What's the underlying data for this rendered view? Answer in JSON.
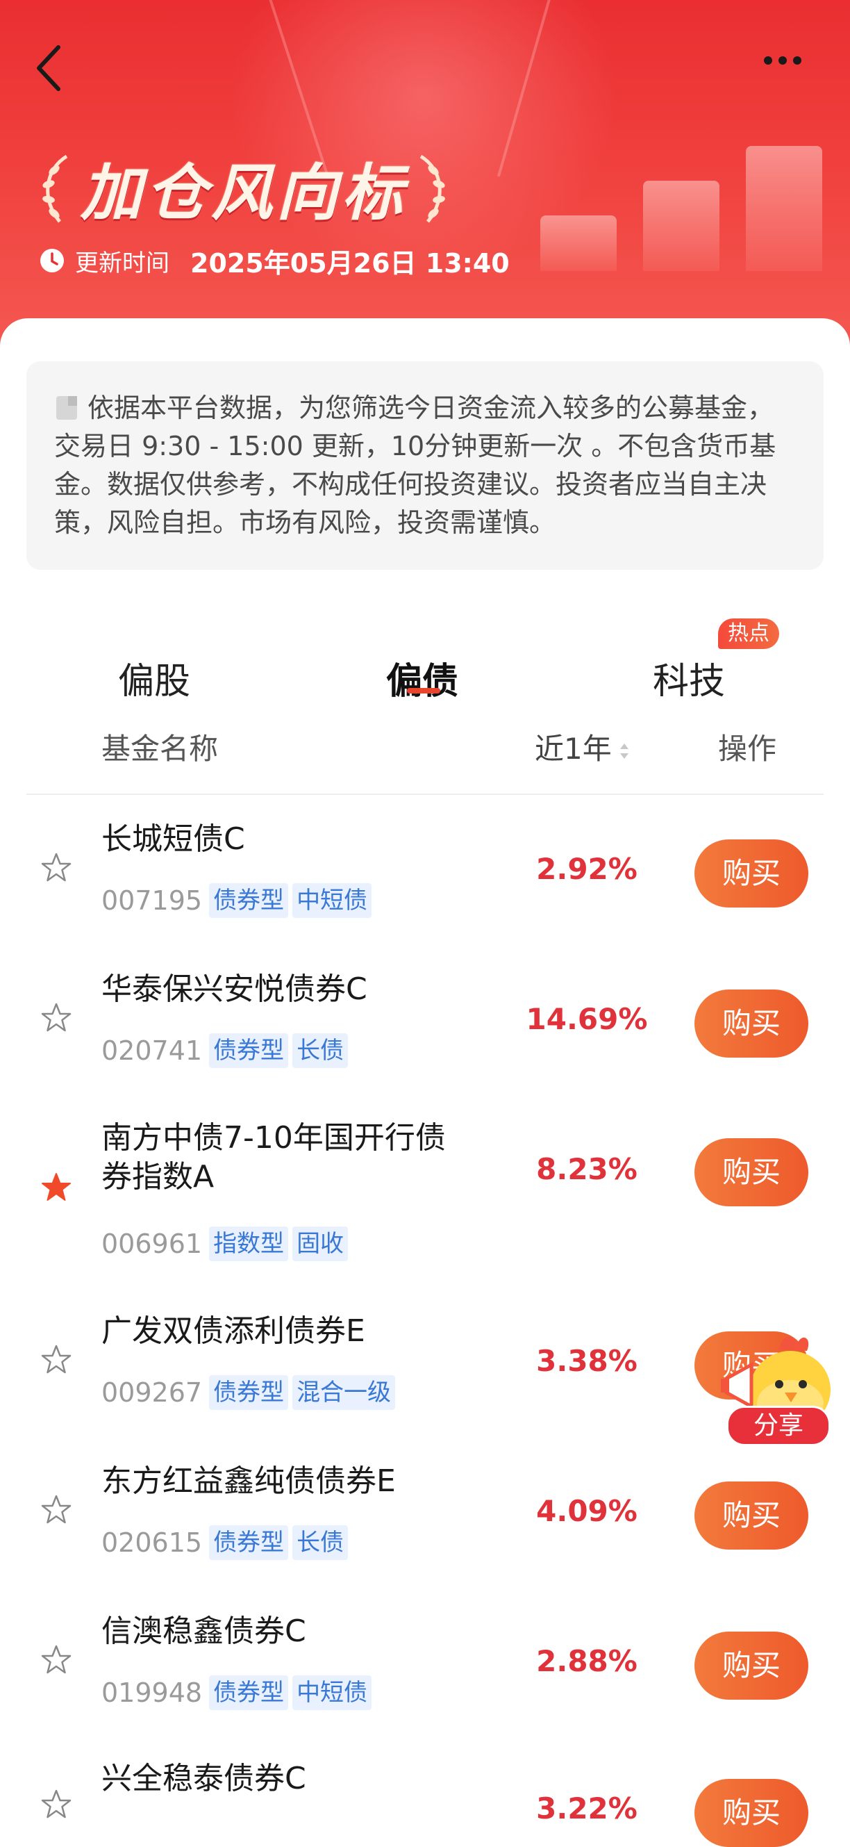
{
  "header": {
    "title": "加仓风向标",
    "update_label": "更新时间",
    "update_time": "2025年05月26日 13:40"
  },
  "notice": {
    "text": "依据本平台数据，为您筛选今日资金流入较多的公募基金，交易日 9:30 - 15:00 更新，10分钟更新一次 。不包含货币基金。数据仅供参考，不构成任何投资建议。投资者应当自主决策，风险自担。市场有风险，投资需谨慎。"
  },
  "tabs": [
    {
      "label": "偏股",
      "active": false
    },
    {
      "label": "偏债",
      "active": true
    },
    {
      "label": "科技",
      "active": false,
      "badge": "热点"
    }
  ],
  "columns": {
    "name": "基金名称",
    "return": "近1年",
    "action": "操作"
  },
  "funds": [
    {
      "name": "长城短债C",
      "code": "007195",
      "tags": [
        "债券型",
        "中短债"
      ],
      "return": "2.92%",
      "starred": false,
      "action": "购买"
    },
    {
      "name": "华泰保兴安悦债券C",
      "code": "020741",
      "tags": [
        "债券型",
        "长债"
      ],
      "return": "14.69%",
      "starred": false,
      "action": "购买"
    },
    {
      "name": "南方中债7-10年国开行债券指数A",
      "code": "006961",
      "tags": [
        "指数型",
        "固收"
      ],
      "return": "8.23%",
      "starred": true,
      "action": "购买"
    },
    {
      "name": "广发双债添利债券E",
      "code": "009267",
      "tags": [
        "债券型",
        "混合一级"
      ],
      "return": "3.38%",
      "starred": false,
      "action": "购买"
    },
    {
      "name": "东方红益鑫纯债债券E",
      "code": "020615",
      "tags": [
        "债券型",
        "长债"
      ],
      "return": "4.09%",
      "starred": false,
      "action": "购买"
    },
    {
      "name": "信澳稳鑫债券C",
      "code": "019948",
      "tags": [
        "债券型",
        "中短债"
      ],
      "return": "2.88%",
      "starred": false,
      "action": "购买"
    },
    {
      "name": "兴全稳泰债券C",
      "code": "",
      "tags": [],
      "return": "3.22%",
      "starred": false,
      "action": "购买"
    }
  ],
  "share_label": "分享",
  "colors": {
    "header_red": "#ea2e31",
    "return_red": "#e0323a",
    "buy_orange": "#f27a3c",
    "tag_blue": "#3a78d6",
    "tab_indicator": "#e8442e",
    "star_active": "#f04a2a"
  },
  "icons": [
    "back-arrow-icon",
    "more-icon",
    "laurel-icon",
    "clock-icon",
    "document-icon",
    "sort-icon",
    "star-icon",
    "mascot-icon"
  ]
}
